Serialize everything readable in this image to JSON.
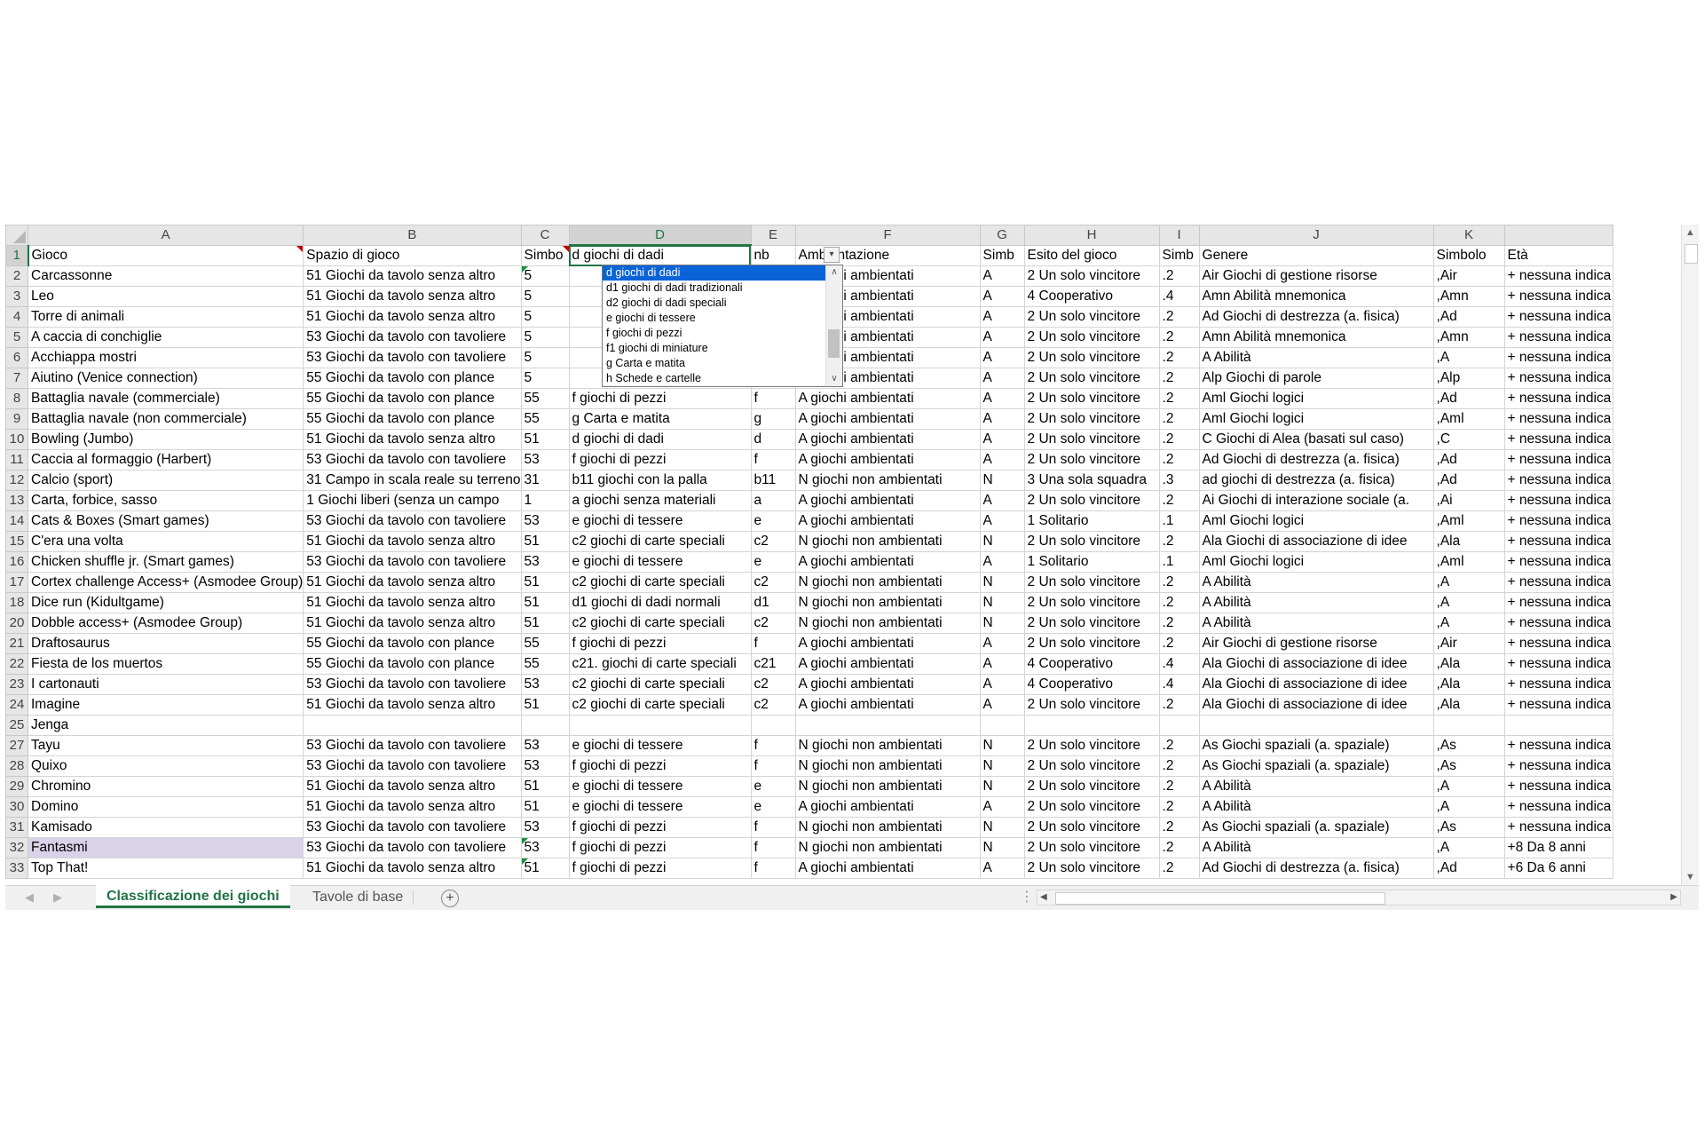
{
  "columns": [
    "A",
    "B",
    "C",
    "D",
    "E",
    "F",
    "G",
    "H",
    "I",
    "J",
    "K"
  ],
  "selected_column": "D",
  "row1": {
    "num": "1",
    "cells": [
      "Gioco",
      "Spazio di gioco",
      "Simbo",
      "d giochi di dadi",
      "nb",
      "Ambientazione",
      "Simb",
      "Esito del gioco",
      "Simb",
      "Genere",
      "Simbolo",
      "Età"
    ]
  },
  "dropdown": {
    "options": [
      "d giochi di dadi",
      "d1 giochi di dadi tradizionali",
      "d2 giochi di dadi speciali",
      "e giochi di tessere",
      "f giochi di pezzi",
      "f1 giochi di miniature",
      "g Carta e matita",
      "h Schede e cartelle"
    ],
    "selected_index": 0
  },
  "rows": [
    {
      "num": "2",
      "cells": [
        "Carcassonne",
        "51 Giochi da tavolo senza altro",
        "5",
        "",
        "",
        "A giochi ambientati",
        "A",
        "2 Un solo vincitore",
        ".2",
        "Air Giochi di gestione risorse",
        ",Air",
        "+ nessuna indica"
      ]
    },
    {
      "num": "3",
      "cells": [
        "Leo",
        "51 Giochi da tavolo senza altro",
        "5",
        "",
        "",
        "A giochi ambientati",
        "A",
        "4 Cooperativo",
        ".4",
        "Amn Abilità mnemonica",
        ",Amn",
        "+ nessuna indica"
      ]
    },
    {
      "num": "4",
      "cells": [
        "Torre di animali",
        "51 Giochi da tavolo senza altro",
        "5",
        "",
        "",
        "A giochi ambientati",
        "A",
        "2 Un solo vincitore",
        ".2",
        "Ad Giochi di destrezza (a. fisica)",
        ",Ad",
        "+ nessuna indica"
      ]
    },
    {
      "num": "5",
      "cells": [
        "A caccia di conchiglie",
        "53 Giochi da tavolo con tavoliere",
        "5",
        "",
        "",
        "A giochi ambientati",
        "A",
        "2 Un solo vincitore",
        ".2",
        "Amn Abilità mnemonica",
        ",Amn",
        "+ nessuna indica"
      ]
    },
    {
      "num": "6",
      "cells": [
        "Acchiappa mostri",
        "53 Giochi da tavolo con tavoliere",
        "5",
        "",
        "",
        "A giochi ambientati",
        "A",
        "2 Un solo vincitore",
        ".2",
        "A Abilità",
        ",A",
        "+ nessuna indica"
      ]
    },
    {
      "num": "7",
      "cells": [
        "Aiutino (Venice connection)",
        "55 Giochi da tavolo con plance",
        "5",
        "",
        "",
        "A giochi ambientati",
        "A",
        "2 Un solo vincitore",
        ".2",
        "Alp Giochi di parole",
        ",Alp",
        "+ nessuna indica"
      ]
    },
    {
      "num": "8",
      "cells": [
        "Battaglia navale (commerciale)",
        "55 Giochi da tavolo con plance",
        "55",
        "f giochi di pezzi",
        "f",
        "A giochi ambientati",
        "A",
        "2 Un solo vincitore",
        ".2",
        "Aml Giochi logici",
        ",Ad",
        "+ nessuna indica"
      ]
    },
    {
      "num": "9",
      "cells": [
        "Battaglia navale (non commerciale)",
        "55 Giochi da tavolo con plance",
        "55",
        "g Carta e matita",
        "g",
        "A giochi ambientati",
        "A",
        "2 Un solo vincitore",
        ".2",
        "Aml Giochi logici",
        ",Aml",
        "+ nessuna indica"
      ]
    },
    {
      "num": "10",
      "cells": [
        "Bowling (Jumbo)",
        "51 Giochi da tavolo senza altro",
        "51",
        "d giochi di dadi",
        "d",
        "A giochi ambientati",
        "A",
        "2 Un solo vincitore",
        ".2",
        "C Giochi di Alea (basati sul caso)",
        ",C",
        "+ nessuna indica"
      ]
    },
    {
      "num": "11",
      "cells": [
        "Caccia al formaggio (Harbert)",
        "53 Giochi da tavolo con tavoliere",
        "53",
        "f giochi di pezzi",
        "f",
        "A giochi ambientati",
        "A",
        "2 Un solo vincitore",
        ".2",
        "Ad Giochi di destrezza (a. fisica)",
        ",Ad",
        "+ nessuna indica"
      ]
    },
    {
      "num": "12",
      "cells": [
        "Calcio (sport)",
        "31 Campo in scala reale su terreno",
        "31",
        "b11 giochi con la palla",
        "b11",
        "N giochi non ambientati",
        "N",
        "3 Una sola squadra",
        ".3",
        "ad giochi di destrezza (a. fisica)",
        ",Ad",
        "+ nessuna indica"
      ]
    },
    {
      "num": "13",
      "cells": [
        "Carta, forbice, sasso",
        "1 Giochi liberi (senza un campo",
        "1",
        "a giochi senza materiali",
        "a",
        "A giochi ambientati",
        "A",
        "2 Un solo vincitore",
        ".2",
        "Ai Giochi di interazione sociale (a.",
        ",Ai",
        "+ nessuna indica"
      ]
    },
    {
      "num": "14",
      "cells": [
        "Cats & Boxes (Smart games)",
        "53 Giochi da tavolo con tavoliere",
        "53",
        "e giochi di tessere",
        "e",
        "A giochi ambientati",
        "A",
        "1 Solitario",
        ".1",
        "Aml Giochi logici",
        ",Aml",
        "+ nessuna indica"
      ]
    },
    {
      "num": "15",
      "cells": [
        "C'era una volta",
        "51 Giochi da tavolo senza altro",
        "51",
        "c2 giochi di carte speciali",
        "c2",
        "N giochi non ambientati",
        "N",
        "2 Un solo vincitore",
        ".2",
        "Ala Giochi di associazione di idee",
        ",Ala",
        "+ nessuna indica"
      ]
    },
    {
      "num": "16",
      "cells": [
        "Chicken shuffle jr. (Smart games)",
        "53 Giochi da tavolo con tavoliere",
        "53",
        "e giochi di tessere",
        "e",
        "A giochi ambientati",
        "A",
        "1 Solitario",
        ".1",
        "Aml Giochi logici",
        ",Aml",
        "+ nessuna indica"
      ]
    },
    {
      "num": "17",
      "cells": [
        "Cortex challenge Access+ (Asmodee Group)",
        "51 Giochi da tavolo senza altro",
        "51",
        "c2 giochi di carte speciali",
        "c2",
        "N giochi non ambientati",
        "N",
        "2 Un solo vincitore",
        ".2",
        "A Abilità",
        ",A",
        "+ nessuna indica"
      ]
    },
    {
      "num": "18",
      "cells": [
        "Dice run (Kidultgame)",
        "51 Giochi da tavolo senza altro",
        "51",
        "d1 giochi di dadi normali",
        "d1",
        "N giochi non ambientati",
        "N",
        "2 Un solo vincitore",
        ".2",
        "A Abilità",
        ",A",
        "+ nessuna indica"
      ]
    },
    {
      "num": "20",
      "cells": [
        "Dobble access+ (Asmodee Group)",
        "51 Giochi da tavolo senza altro",
        "51",
        "c2 giochi di carte speciali",
        "c2",
        "N giochi non ambientati",
        "N",
        "2 Un solo vincitore",
        ".2",
        "A Abilità",
        ",A",
        "+ nessuna indica"
      ]
    },
    {
      "num": "21",
      "cells": [
        "Draftosaurus",
        "55 Giochi da tavolo con plance",
        "55",
        "f giochi di pezzi",
        "f",
        "A giochi ambientati",
        "A",
        "2 Un solo vincitore",
        ".2",
        "Air Giochi di gestione risorse",
        ",Air",
        "+ nessuna indica"
      ]
    },
    {
      "num": "22",
      "cells": [
        "Fiesta de los muertos",
        "55 Giochi da tavolo con plance",
        "55",
        "c21. giochi di carte speciali",
        "c21",
        "A giochi ambientati",
        "A",
        "4 Cooperativo",
        ".4",
        "Ala Giochi di associazione di idee",
        ",Ala",
        "+ nessuna indica"
      ]
    },
    {
      "num": "23",
      "cells": [
        "I cartonauti",
        "53 Giochi da tavolo con tavoliere",
        "53",
        "c2 giochi di carte speciali",
        "c2",
        "A giochi ambientati",
        "A",
        "4 Cooperativo",
        ".4",
        "Ala Giochi di associazione di idee",
        ",Ala",
        "+ nessuna indica"
      ]
    },
    {
      "num": "24",
      "cells": [
        "Imagine",
        "51 Giochi da tavolo senza altro",
        "51",
        "c2 giochi di carte speciali",
        "c2",
        "A giochi ambientati",
        "A",
        "2 Un solo vincitore",
        ".2",
        "Ala Giochi di associazione di idee",
        ",Ala",
        "+ nessuna indica"
      ]
    },
    {
      "num": "25",
      "cells": [
        "Jenga",
        "",
        "",
        "",
        "",
        "",
        "",
        "",
        "",
        "",
        "",
        ""
      ]
    },
    {
      "num": "27",
      "cells": [
        "Tayu",
        "53 Giochi da tavolo con tavoliere",
        "53",
        "e giochi di tessere",
        "f",
        "N giochi non ambientati",
        "N",
        "2 Un solo vincitore",
        ".2",
        "As Giochi spaziali (a. spaziale)",
        ",As",
        "+ nessuna indica"
      ]
    },
    {
      "num": "28",
      "cells": [
        "Quixo",
        "53 Giochi da tavolo con tavoliere",
        "53",
        "f giochi di pezzi",
        "f",
        "N giochi non ambientati",
        "N",
        "2 Un solo vincitore",
        ".2",
        "As Giochi spaziali (a. spaziale)",
        ",As",
        "+ nessuna indica"
      ]
    },
    {
      "num": "29",
      "cells": [
        "Chromino",
        "51 Giochi da tavolo senza altro",
        "51",
        "e giochi di tessere",
        "e",
        "N giochi non ambientati",
        "N",
        "2 Un solo vincitore",
        ".2",
        "A Abilità",
        ",A",
        "+ nessuna indica"
      ]
    },
    {
      "num": "30",
      "cells": [
        "Domino",
        "51 Giochi da tavolo senza altro",
        "51",
        "e giochi di tessere",
        "e",
        "A giochi ambientati",
        "A",
        "2 Un solo vincitore",
        ".2",
        "A Abilità",
        ",A",
        "+ nessuna indica"
      ]
    },
    {
      "num": "31",
      "cells": [
        "Kamisado",
        "53 Giochi da tavolo con tavoliere",
        "53",
        "f giochi di pezzi",
        "f",
        "N giochi non ambientati",
        "N",
        "2 Un solo vincitore",
        ".2",
        "As Giochi spaziali (a. spaziale)",
        ",As",
        "+ nessuna indica"
      ]
    },
    {
      "num": "32",
      "cells": [
        "Fantasmi",
        "53 Giochi da tavolo con tavoliere",
        "53",
        "f giochi di pezzi",
        "f",
        "N giochi non ambientati",
        "N",
        "2 Un solo vincitore",
        ".2",
        "A Abilità",
        ",A",
        "+8 Da 8 anni"
      ]
    },
    {
      "num": "33",
      "cells": [
        "Top That!",
        "51 Giochi da tavolo senza altro",
        "51",
        "f giochi di pezzi",
        "f",
        "A giochi ambientati",
        "A",
        "2 Un solo vincitore",
        ".2",
        "Ad Giochi di destrezza (a. fisica)",
        ",Ad",
        "+6 Da 6 anni"
      ]
    }
  ],
  "highlighted_row": "32",
  "sheet_tabs": [
    "Classificazione dei giochi",
    "Tavole di base"
  ],
  "active_tab": 0,
  "icons": {
    "add_sheet": "plus-circle-icon",
    "dropdown": "chevron-down-icon",
    "scroll_up": "arrow-up-icon",
    "scroll_down": "arrow-down-icon",
    "scroll_left": "arrow-left-icon",
    "scroll_right": "arrow-right-icon"
  },
  "colors": {
    "accent": "#217346",
    "selection": "#0a64d8",
    "highlight_row": "#d9d2e9",
    "comment_marker": "#c00000"
  }
}
